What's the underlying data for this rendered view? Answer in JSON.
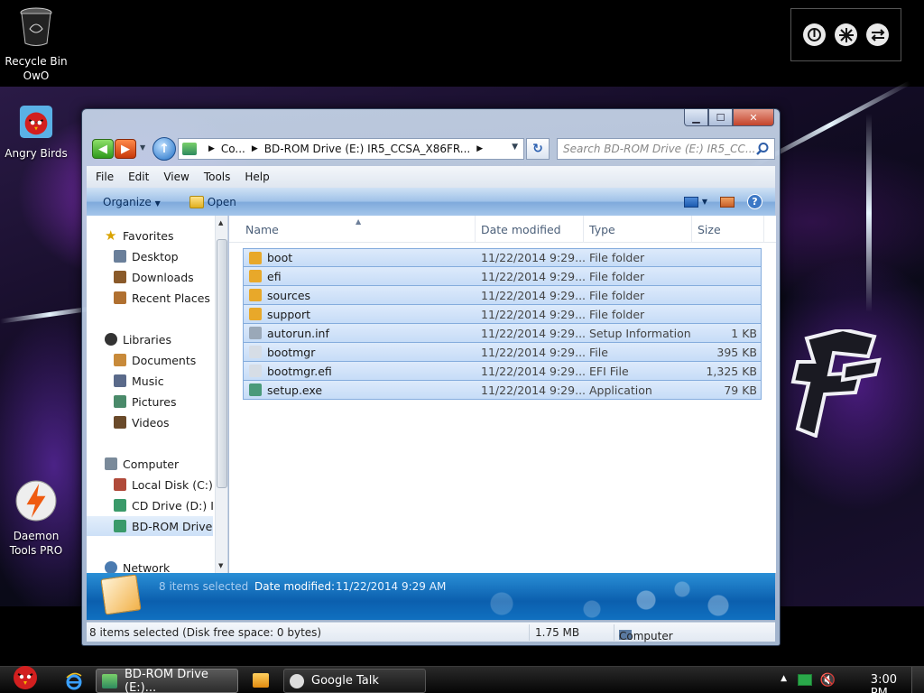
{
  "desktop": {
    "icons": [
      {
        "label1": "Recycle Bin",
        "label2": "OwO"
      },
      {
        "label1": "Angry Birds",
        "label2": ""
      },
      {
        "label1": "Daemon",
        "label2": "Tools PRO"
      }
    ]
  },
  "window": {
    "address": {
      "crumb1": "Co...",
      "crumb2": "BD-ROM Drive (E:) IR5_CCSA_X86FR..."
    },
    "search_placeholder": "Search BD-ROM Drive (E:) IR5_CC...",
    "menu": [
      "File",
      "Edit",
      "View",
      "Tools",
      "Help"
    ],
    "toolbar": {
      "organize": "Organize",
      "open": "Open"
    },
    "nav": {
      "favorites": "Favorites",
      "desktop": "Desktop",
      "downloads": "Downloads",
      "recent": "Recent Places",
      "libraries": "Libraries",
      "documents": "Documents",
      "music": "Music",
      "pictures": "Pictures",
      "videos": "Videos",
      "computer": "Computer",
      "local_disk": "Local Disk (C:)",
      "cd_drive": "CD Drive (D:) IR",
      "bd_drive": "BD-ROM Drive",
      "network": "Network"
    },
    "columns": {
      "name": "Name",
      "date": "Date modified",
      "type": "Type",
      "size": "Size"
    },
    "files": [
      {
        "name": "boot",
        "date": "11/22/2014 9:29...",
        "type": "File folder",
        "size": "",
        "kind": "folder"
      },
      {
        "name": "efi",
        "date": "11/22/2014 9:29...",
        "type": "File folder",
        "size": "",
        "kind": "folder"
      },
      {
        "name": "sources",
        "date": "11/22/2014 9:29...",
        "type": "File folder",
        "size": "",
        "kind": "folder"
      },
      {
        "name": "support",
        "date": "11/22/2014 9:29...",
        "type": "File folder",
        "size": "",
        "kind": "folder"
      },
      {
        "name": "autorun.inf",
        "date": "11/22/2014 9:29...",
        "type": "Setup Information",
        "size": "1 KB",
        "kind": "inf"
      },
      {
        "name": "bootmgr",
        "date": "11/22/2014 9:29...",
        "type": "File",
        "size": "395 KB",
        "kind": "file"
      },
      {
        "name": "bootmgr.efi",
        "date": "11/22/2014 9:29...",
        "type": "EFI File",
        "size": "1,325 KB",
        "kind": "file"
      },
      {
        "name": "setup.exe",
        "date": "11/22/2014 9:29...",
        "type": "Application",
        "size": "79 KB",
        "kind": "exe"
      }
    ],
    "details": {
      "selected": "8 items selected",
      "date_label": "Date modified:",
      "date_value": "11/22/2014 9:29 AM"
    },
    "status": {
      "left": "8 items selected (Disk free space: 0 bytes)",
      "size": "1.75 MB",
      "location": "Computer"
    }
  },
  "taskbar": {
    "explorer": "BD-ROM Drive (E:)...",
    "google_talk": "Google Talk",
    "clock": "3:00 PM"
  }
}
